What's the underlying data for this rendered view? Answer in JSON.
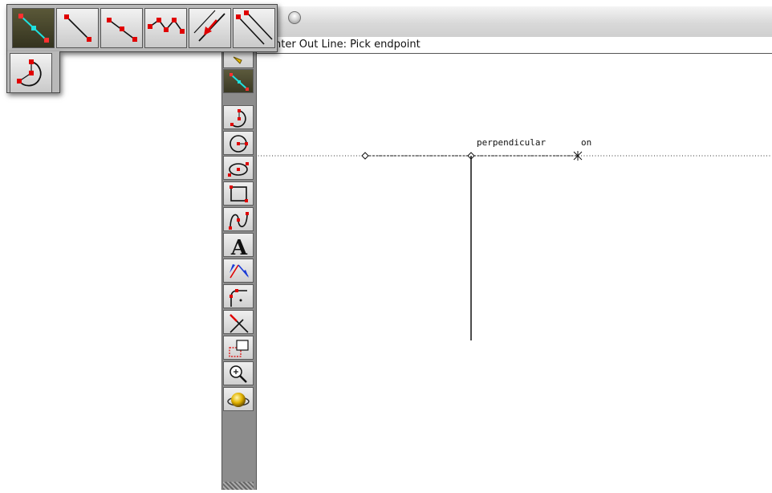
{
  "prompt": "nter Out Line: Pick endpoint",
  "canvas": {
    "snap_labels": {
      "perpendicular": "perpendicular",
      "on": "on"
    }
  },
  "popup_palette": {
    "tools": [
      "center-out-line-icon",
      "two-point-line-icon",
      "bisector-line-icon",
      "polyline-icon",
      "offset-line-icon",
      "parallel-line-icon",
      "center-arc-icon"
    ],
    "selected": "center-out-line-icon"
  },
  "vertical_palette": {
    "tools": [
      "selection-arrow-icon",
      "line-tool-icon",
      "arc-tool-icon",
      "circle-tool-icon",
      "ellipse-tool-icon",
      "rectangle-tool-icon",
      "spline-tool-icon",
      "text-tool-icon",
      "dimension-tool-icon",
      "fillet-tool-icon",
      "trim-tool-icon",
      "marquee-tool-icon",
      "zoom-tool-icon",
      "render-tool-icon"
    ],
    "selected": "line-tool-icon",
    "text_tool_glyph": "A"
  },
  "colors": {
    "accent_red": "#d40000",
    "accent_cyan": "#18d6d6",
    "selected_tool_bg": "#4a4830",
    "palette_gray": "#b9b9b9"
  }
}
